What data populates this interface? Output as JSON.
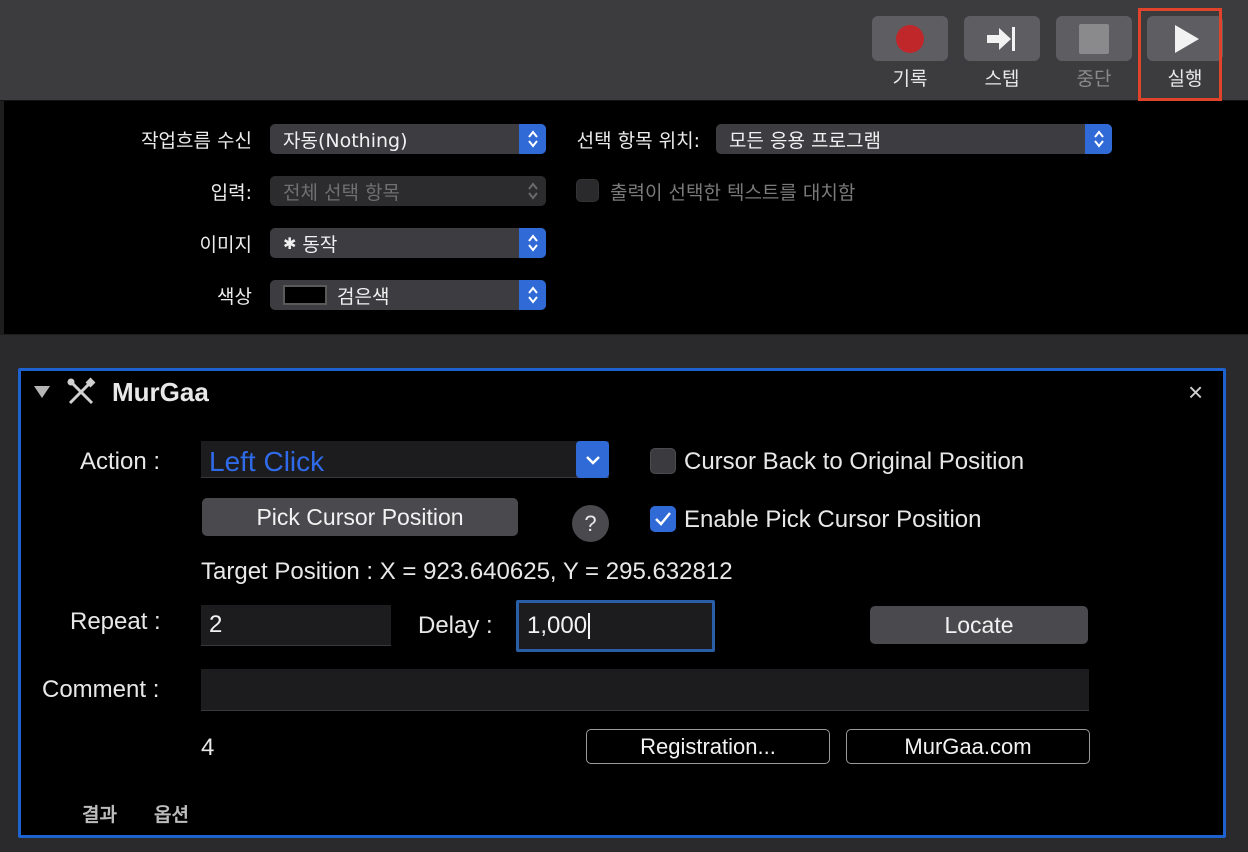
{
  "toolbar": {
    "record_label": "기록",
    "step_label": "스텝",
    "stop_label": "중단",
    "run_label": "실행"
  },
  "workflow": {
    "receives_label": "작업흐름 수신",
    "receives_value": "자동(Nothing)",
    "location_label": "선택 항목 위치:",
    "location_value": "모든 응용 프로그램",
    "input_label": "입력:",
    "input_value": "전체 선택 항목",
    "replace_label": "출력이 선택한 텍스트를 대치함",
    "image_label": "이미지",
    "image_value": "동작",
    "color_label": "색상",
    "color_value": "검은색"
  },
  "action": {
    "title": "MurGaa",
    "close": "×",
    "action_label": "Action :",
    "action_value": "Left Click",
    "cursor_back_label": "Cursor Back to Original Position",
    "cursor_back_checked": false,
    "pick_button": "Pick Cursor Position",
    "help": "?",
    "enable_pick_label": "Enable Pick Cursor Position",
    "enable_pick_checked": true,
    "target_position": "Target Position : X = 923.640625, Y = 295.632812",
    "repeat_label": "Repeat :",
    "repeat_value": "2",
    "delay_label": "Delay :",
    "delay_value": "1,000",
    "locate_button": "Locate",
    "comment_label": "Comment :",
    "comment_value": "",
    "count": "4",
    "registration_button": "Registration...",
    "website_button": "MurGaa.com",
    "tab_results": "결과",
    "tab_options": "옵션"
  },
  "colors": {
    "accent": "#2f6ad6",
    "record": "#c0272b",
    "highlight": "#e0452b"
  }
}
